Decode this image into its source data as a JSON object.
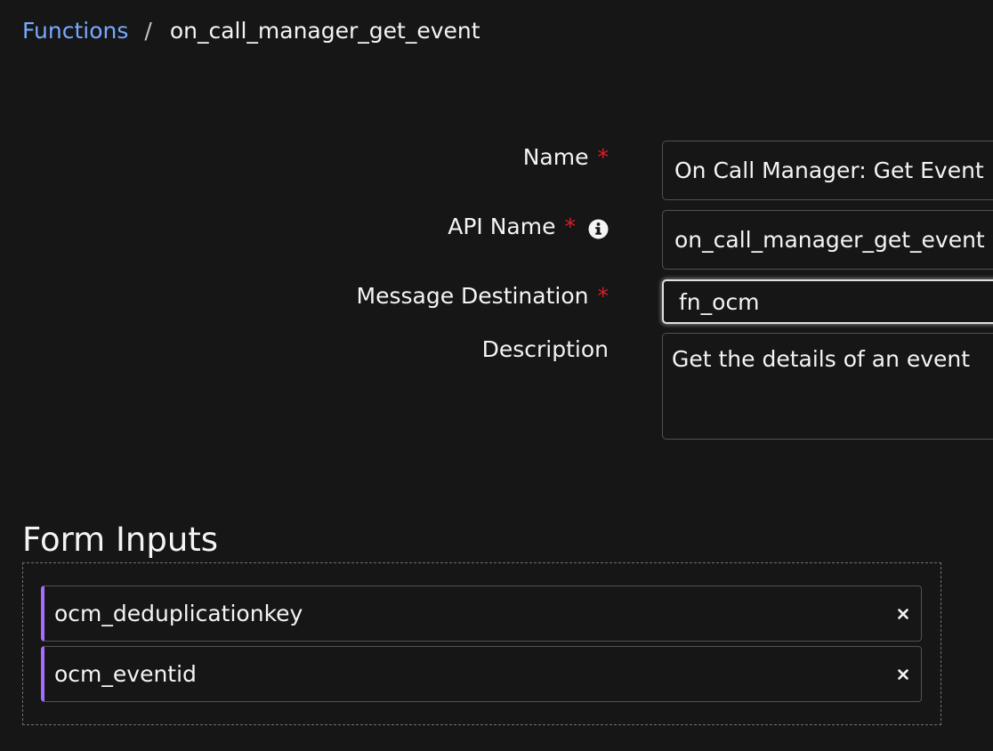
{
  "breadcrumb": {
    "parent": "Functions",
    "separator": "/",
    "current": "on_call_manager_get_event"
  },
  "form": {
    "name": {
      "label": "Name",
      "required_mark": "*",
      "value": "On Call Manager: Get Event"
    },
    "api_name": {
      "label": "API Name",
      "required_mark": "*",
      "icon": "info-icon",
      "value": "on_call_manager_get_event"
    },
    "message_destination": {
      "label": "Message Destination",
      "required_mark": "*",
      "value": "fn_ocm"
    },
    "description": {
      "label": "Description",
      "value": "Get the details of an event"
    }
  },
  "form_inputs": {
    "title": "Form Inputs",
    "items": [
      {
        "label": "ocm_deduplicationkey",
        "icon": "close-icon"
      },
      {
        "label": "ocm_eventid",
        "icon": "close-icon"
      }
    ]
  },
  "colors": {
    "background": "#161616",
    "link": "#78a9ff",
    "required": "#da1e28",
    "item_accent": "#a56eff",
    "border": "#525252"
  }
}
